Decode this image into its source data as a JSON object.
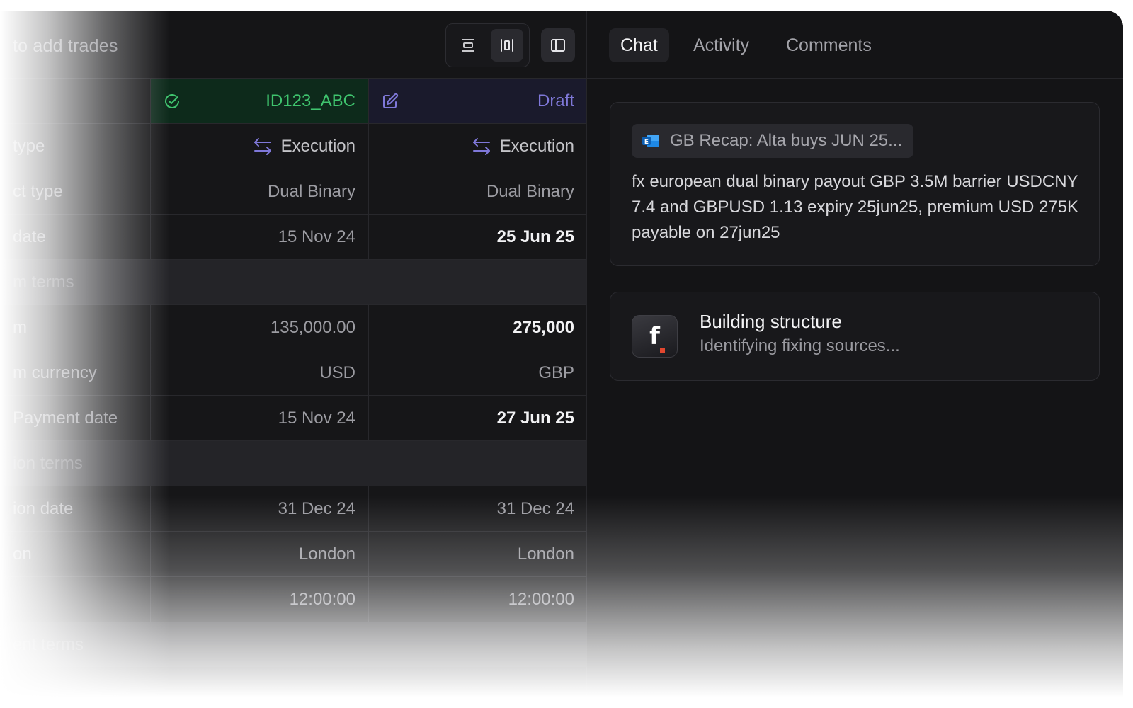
{
  "colors": {
    "accent_green": "#3fc46e",
    "accent_purple": "#7f78d9",
    "background": "#141416"
  },
  "toolbar": {
    "search_hint": "to add trades",
    "view_toggle": [
      {
        "icon": "align-center-icon"
      },
      {
        "icon": "columns-icon",
        "active": true
      }
    ],
    "sidebar_icon": "sidebar-toggle-icon"
  },
  "columns": [
    {
      "label": "ID123_ABC",
      "icon": "check-circle-icon",
      "status": "confirmed"
    },
    {
      "label": "Draft",
      "icon": "edit-icon",
      "status": "draft"
    }
  ],
  "rows": [
    {
      "label": "type",
      "values": [
        "Execution",
        "Execution"
      ],
      "kind": "execution"
    },
    {
      "label": "ct type",
      "values": [
        "Dual Binary",
        "Dual Binary"
      ]
    },
    {
      "label": "date",
      "values": [
        "15 Nov 24",
        "25 Jun 25"
      ],
      "changed": true
    },
    {
      "label": "m terms",
      "section": true
    },
    {
      "label": "m",
      "values": [
        "135,000.00",
        "275,000"
      ],
      "changed": true
    },
    {
      "label": "m currency",
      "values": [
        "USD",
        "GBP"
      ]
    },
    {
      "label": "Payment date",
      "values": [
        "15 Nov 24",
        "27 Jun 25"
      ],
      "changed": true
    },
    {
      "label": "ion terms",
      "section": true
    },
    {
      "label": "ion date",
      "values": [
        "31 Dec 24",
        "31 Dec 24"
      ]
    },
    {
      "label": "on",
      "values": [
        "London",
        "London"
      ]
    },
    {
      "label": "",
      "values": [
        "12:00:00",
        "12:00:00"
      ]
    },
    {
      "label": "ent terms",
      "section": true
    }
  ],
  "chat": {
    "tabs": [
      "Chat",
      "Activity",
      "Comments"
    ],
    "active_tab": "Chat",
    "email_chip": "GB Recap: Alta buys JUN 25...",
    "message": "fx european dual binary payout GBP 3.5M barrier USDCNY 7.4 and GBPUSD 1.13 expiry 25jun25, premium USD 275K payable on 27jun25",
    "status_card": {
      "logo_letter": "f",
      "title": "Building structure",
      "subtitle": "Identifying fixing sources..."
    }
  }
}
